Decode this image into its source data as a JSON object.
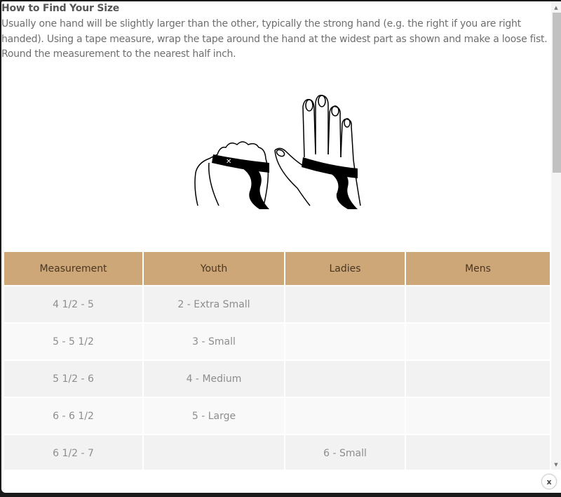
{
  "guide": {
    "title": "How to Find Your Size",
    "intro": "Usually one hand will be slightly larger than the other, typically the strong hand (e.g. the right if you are right handed). Using a tape measure, wrap the tape around the hand at the widest part as shown and make a loose fist. Round the measurement to the nearest half inch.",
    "illustration": "hand-measuring-illustration"
  },
  "table": {
    "headers": [
      "Measurement",
      "Youth",
      "Ladies",
      "Mens"
    ],
    "rows": [
      [
        "4 1/2 - 5",
        "2 - Extra Small",
        "",
        ""
      ],
      [
        "5 - 5 1/2",
        "3 - Small",
        "",
        ""
      ],
      [
        "5 1/2 - 6",
        "4 - Medium",
        "",
        ""
      ],
      [
        "6 - 6 1/2",
        "5 - Large",
        "",
        ""
      ],
      [
        "6 1/2 - 7",
        "",
        "6 - Small",
        ""
      ]
    ],
    "header_color": "#cda777"
  },
  "scrollbar": {
    "up_icon": "▲",
    "down_icon": "▼"
  },
  "close": {
    "label": "x"
  }
}
